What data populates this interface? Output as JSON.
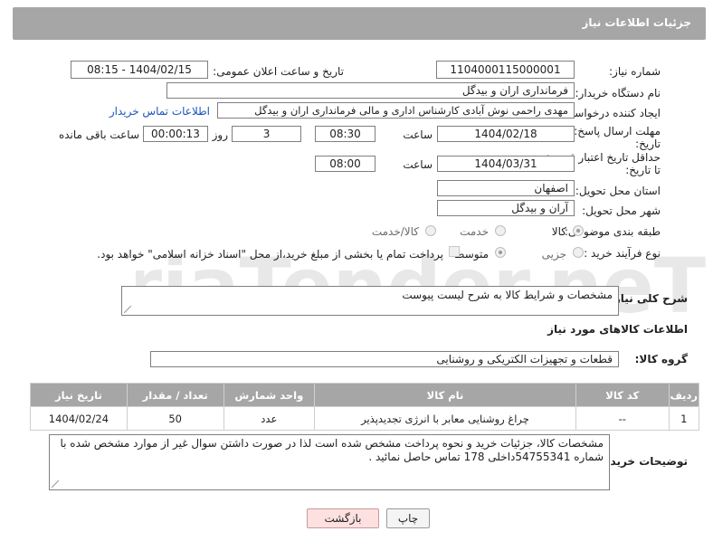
{
  "header": {
    "title": "جزئیات اطلاعات نیاز"
  },
  "form": {
    "need_number": {
      "label": "شماره نیاز:",
      "value": "1104000115000001"
    },
    "announce_datetime": {
      "label": "تاریخ و ساعت اعلان عمومی:",
      "value": "1404/02/15 - 08:15"
    },
    "buyer_org": {
      "label": "نام دستگاه خریدار:",
      "value": "فرمانداری اران و بیدگل"
    },
    "requester": {
      "label": "ایجاد کننده درخواست:",
      "value": "مهدی راحمی نوش آبادی کارشناس اداری و مالی  فرمانداری اران و بیدگل",
      "contact_link": "اطلاعات تماس خریدار"
    },
    "reply_deadline": {
      "label_line1": "مهلت ارسال پاسخ: تا",
      "label_line2": "تاریخ:",
      "date": "1404/02/18",
      "time_label": "ساعت",
      "time": "08:30",
      "days": "3",
      "days_label": "روز و",
      "remaining": "00:00:13",
      "remaining_label": "ساعت باقی مانده"
    },
    "price_validity": {
      "label_line1": "حداقل تاریخ اعتبار قیمت:",
      "label_line2": "تا تاریخ:",
      "date": "1404/03/31",
      "time_label": "ساعت",
      "time": "08:00"
    },
    "delivery_province": {
      "label": "استان محل تحویل:",
      "value": "اصفهان"
    },
    "delivery_city": {
      "label": "شهر محل تحویل:",
      "value": "آران و بیدگل"
    },
    "category": {
      "label": "طبقه بندی موضوعی:",
      "options": [
        "کالا",
        "خدمت",
        "کالا/خدمت"
      ],
      "selected": "کالا"
    },
    "purchase_type": {
      "label": "نوع فرآیند خرید :",
      "options": [
        "جزیی",
        "متوسط"
      ],
      "selected": "متوسط",
      "checkbox_text": "پرداخت تمام یا بخشی از مبلغ خرید،از محل \"اسناد خزانه اسلامی\" خواهد بود."
    }
  },
  "summary": {
    "label": "شرح کلی نیاز:",
    "value": "مشخصات و شرایط کالا به شرح لیست پیوست"
  },
  "goods_section": {
    "title": "اطلاعات کالاهای مورد نیاز"
  },
  "goods_group": {
    "label": "گروه کالا:",
    "value": "قطعات و تجهیزات الکتریکی و روشنایی"
  },
  "table": {
    "headers": [
      "ردیف",
      "کد کالا",
      "نام کالا",
      "واحد شمارش",
      "تعداد / مقدار",
      "تاریخ نیاز"
    ],
    "rows": [
      [
        "1",
        "--",
        "چراغ روشنایی معابر با انرژی تجدیدپذیر",
        "عدد",
        "50",
        "1404/02/24"
      ]
    ]
  },
  "buyer_notes": {
    "label": "توضیحات خریدار:",
    "value": "مشخصات کالا، جزئیات خرید و نحوه پرداخت مشخص شده است لذا در صورت داشتن سوال غیر از موارد مشخص شده با شماره 54755341داخلی 178 تماس حاصل نمائید ."
  },
  "buttons": {
    "print": "چاپ",
    "back": "بازگشت"
  },
  "watermark": {
    "text": "AriaTender.neT"
  },
  "colors": {
    "header_bg": "#a6a6a6",
    "link": "#1a55c0",
    "back_button_bg": "#fde0e0"
  }
}
